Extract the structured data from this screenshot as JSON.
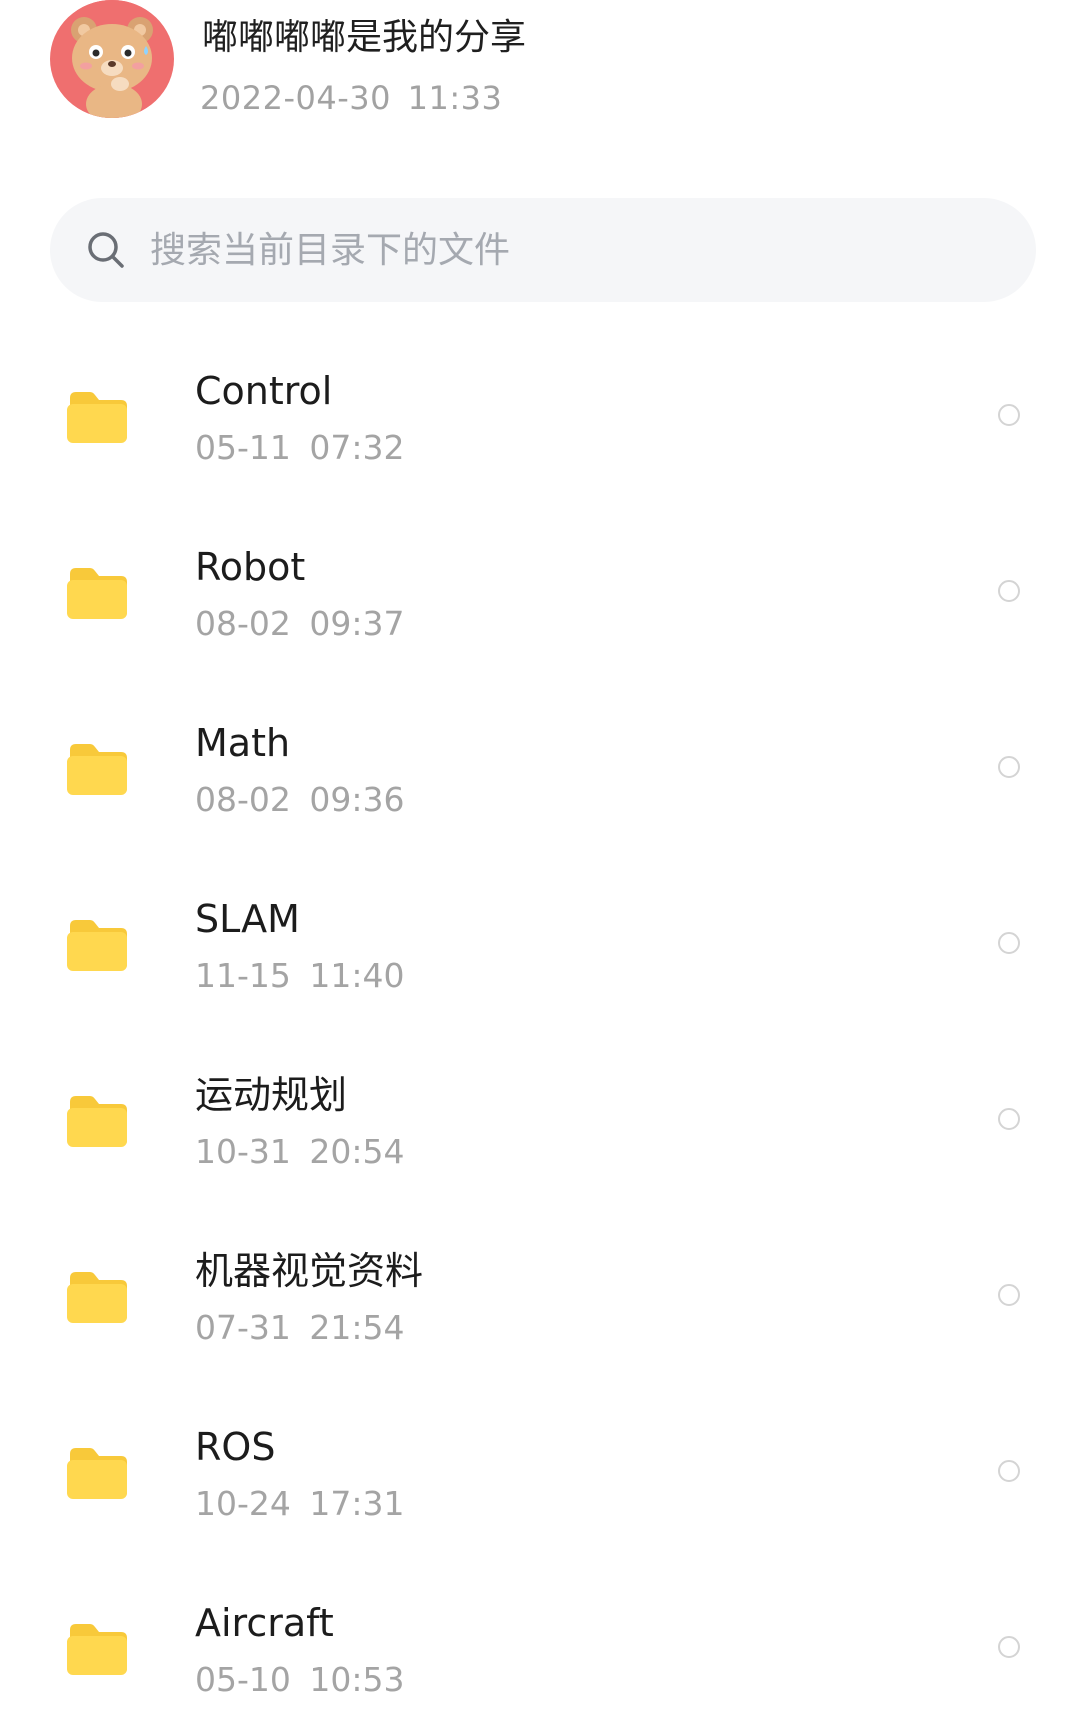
{
  "header": {
    "title": "嘟嘟嘟嘟是我的分享",
    "time": "2022-04-30  11:33"
  },
  "search": {
    "placeholder": "搜索当前目录下的文件"
  },
  "colors": {
    "folder": "#FFD84F",
    "folder_tab": "#F8C93A",
    "avatar_bg": "#EF6F6F"
  },
  "icons": {
    "avatar": "bear-avatar-icon",
    "search": "search-icon",
    "folder": "folder-icon",
    "select": "radio-circle-icon"
  },
  "files": [
    {
      "name": "Control",
      "time": "05-11  07:32"
    },
    {
      "name": "Robot",
      "time": "08-02  09:37"
    },
    {
      "name": "Math",
      "time": "08-02  09:36"
    },
    {
      "name": "SLAM",
      "time": "11-15  11:40"
    },
    {
      "name": "运动规划",
      "time": "10-31  20:54"
    },
    {
      "name": "机器视觉资料",
      "time": "07-31  21:54"
    },
    {
      "name": "ROS",
      "time": "10-24  17:31"
    },
    {
      "name": "Aircraft",
      "time": "05-10  10:53"
    }
  ]
}
